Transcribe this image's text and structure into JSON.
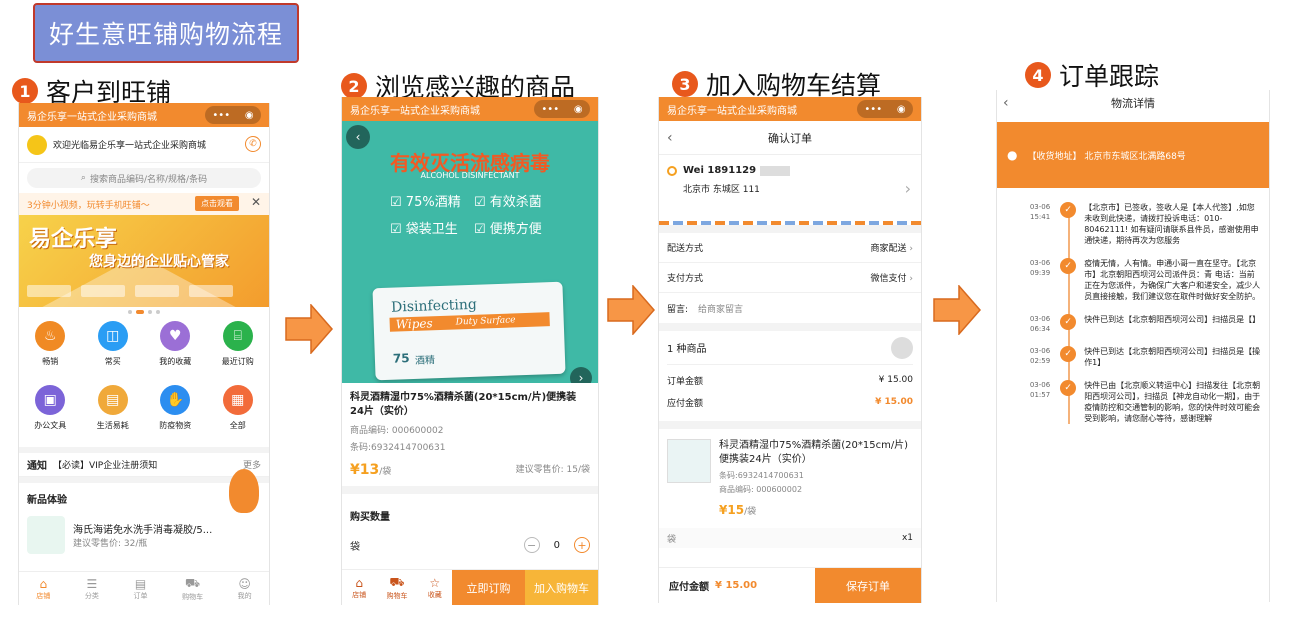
{
  "title": "好生意旺铺购物流程",
  "steps": [
    {
      "num": "1",
      "label": "客户到旺铺"
    },
    {
      "num": "2",
      "label": "浏览感兴趣的商品"
    },
    {
      "num": "3",
      "label": "加入购物车结算"
    },
    {
      "num": "4",
      "label": "订单跟踪"
    }
  ],
  "colors": {
    "accent": "#f28a2e",
    "step": "#e8581c",
    "teal": "#3fb9a6",
    "title_bg": "#7b8fd6",
    "price": "#f5a020"
  },
  "shop_name": "易企乐享一站式企业采购商城",
  "p1": {
    "welcome": "欢迎光临易企乐享一站式企业采购商城",
    "search_placeholder": "搜索商品编码/名称/规格/条码",
    "promo": "3分钟小视频，玩转手机旺铺～",
    "promo_btn": "点击观看",
    "banner_title": "易企乐享",
    "banner_sub": "您身边的企业贴心管家",
    "categories": [
      {
        "label": "畅销",
        "color": "#f08a24",
        "icon": "flame-icon",
        "glyph": "♨"
      },
      {
        "label": "常买",
        "color": "#2a9df4",
        "icon": "bag-icon",
        "glyph": "◫"
      },
      {
        "label": "我的收藏",
        "color": "#9b6fd6",
        "icon": "heart-icon",
        "glyph": "♥"
      },
      {
        "label": "最近订购",
        "color": "#2bb24c",
        "icon": "cart-icon",
        "glyph": "⌸"
      },
      {
        "label": "办公文具",
        "color": "#7c64d8",
        "icon": "briefcase-icon",
        "glyph": "▣"
      },
      {
        "label": "生活易耗",
        "color": "#f0a93a",
        "icon": "box-icon",
        "glyph": "▤"
      },
      {
        "label": "防疫物资",
        "color": "#2c8ef0",
        "icon": "wash-icon",
        "glyph": "✋"
      },
      {
        "label": "全部",
        "color": "#f26b3a",
        "icon": "grid-icon",
        "glyph": "▦"
      }
    ],
    "notice_tag": "通知",
    "notice_text": "【必读】VIP企业注册须知",
    "notice_more": "更多",
    "new_title": "新品体验",
    "new_item": "海氏海诺免水洗手消毒凝胶/5...",
    "new_price": "建议零售价: 32/瓶",
    "nav": [
      "店铺",
      "分类",
      "订单",
      "购物车",
      "我的"
    ]
  },
  "p2": {
    "hero_title": "有效灭活流感病毒",
    "hero_sub": "ALCOHOL DISINFECTANT",
    "checks": [
      "75%酒精",
      "有效杀菌",
      "袋装卫生",
      "便携方便"
    ],
    "pack_line1": "Disinfecting",
    "pack_line2": "Wipes",
    "pack_line3": "Duty Surface",
    "pack_pct": "75",
    "pack_cn": "酒精",
    "product_name": "科灵酒精湿巾75%酒精杀菌(20*15cm/片)便携装24片（实价）",
    "code": "商品编码: 000600002",
    "barcode": "条码:6932414700631",
    "price": "¥13",
    "unit": "/袋",
    "suggest": "建议零售价: 15/袋",
    "qty_title": "购买数量",
    "qty_unit": "袋",
    "qty": "0",
    "nav": [
      "店铺",
      "购物车",
      "收藏"
    ],
    "buy_now": "立即订购",
    "add_cart": "加入购物车"
  },
  "p3": {
    "header": "确认订单",
    "name": "Wei 1891129",
    "address": "北京市 东城区 111",
    "delivery_label": "配送方式",
    "delivery_value": "商家配送",
    "payment_label": "支付方式",
    "payment_value": "微信支付",
    "memo_label": "留言:",
    "memo_placeholder": "给商家留言",
    "count": "1 种商品",
    "order_amount_label": "订单金额",
    "order_amount": "¥ 15.00",
    "pay_amount_label": "应付金额",
    "pay_amount": "¥ 15.00",
    "product_name": "科灵酒精湿巾75%酒精杀菌(20*15cm/片)便携装24片（实价）",
    "barcode": "条码:6932414700631",
    "code": "商品编码: 000600002",
    "price": "¥15",
    "unit": "/袋",
    "qty_unit": "袋",
    "qty": "x1",
    "footer_label": "应付金额",
    "footer_amount": "¥ 15.00",
    "save_btn": "保存订单"
  },
  "p4": {
    "header": "物流详情",
    "address": "【收货地址】 北京市东城区北满路68号",
    "events": [
      {
        "date": "03-06",
        "time": "15:41",
        "text": "【北京市】已签收，签收人是【本人代签】,如您未收到此快递，请拨打投诉电话：010-80462111! 如有疑问请联系县件员，感谢使用申通快递，期待再次为您服务"
      },
      {
        "date": "03-06",
        "time": "09:39",
        "text": "疫情无情，人有情。申通小哥一直在坚守。【北京市】北京朝阳西坝河公司派件员：青 电话：当前正在为您派件，为确保广大客户和递安全，减少人员直接接触，我们建议您在取件时做好安全防护。"
      },
      {
        "date": "03-06",
        "time": "06:34",
        "text": "快件已到达【北京朝阳西坝河公司】扫描员是【】"
      },
      {
        "date": "03-06",
        "time": "02:59",
        "text": "快件已到达【北京朝阳西坝河公司】扫描员是【操作1】"
      },
      {
        "date": "03-06",
        "time": "01:57",
        "text": "快件已由【北京顺义转运中心】扫描发往【北京朝阳西坝河公司】，扫描员【神龙自动化一期】，由于疫情防控和交通管制的影响，您的快件时效可能会受到影响，请您耐心等待，感谢理解"
      }
    ]
  }
}
